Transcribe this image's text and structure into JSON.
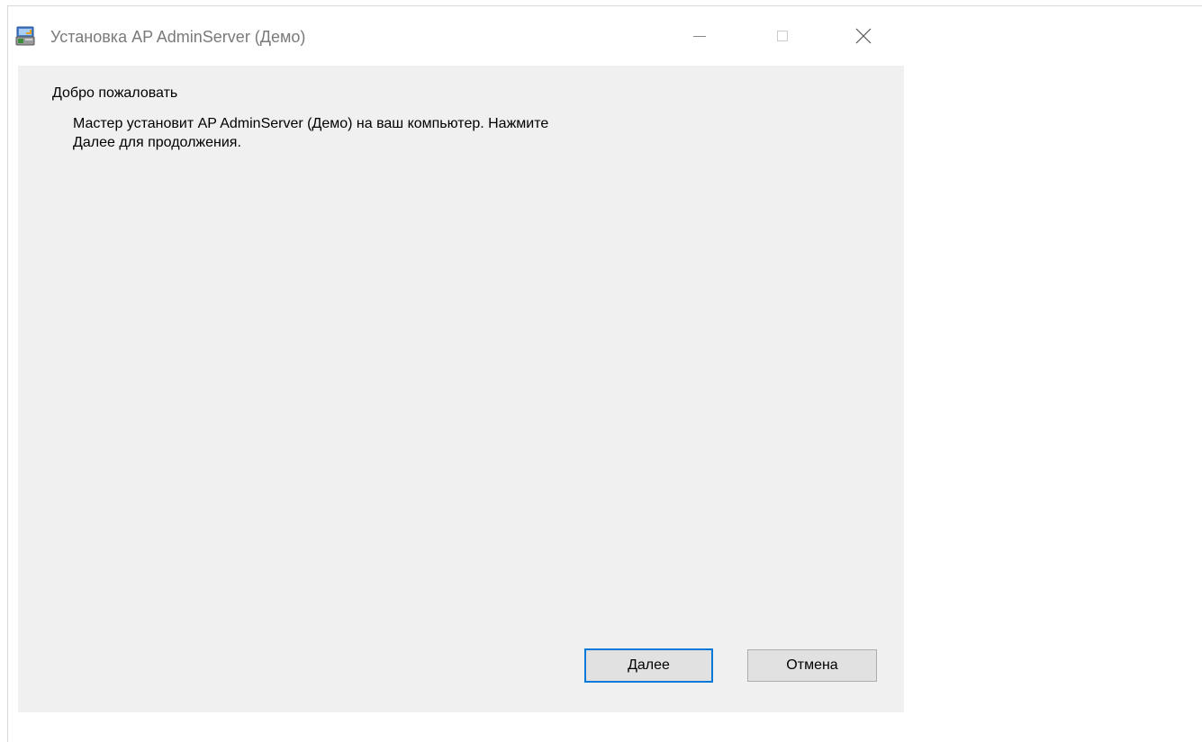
{
  "window": {
    "title": "Установка AP AdminServer (Демо)",
    "icon": "installer-icon",
    "controls": {
      "minimize_icon": "minimize-icon",
      "maximize_icon": "maximize-icon",
      "close_icon": "close-icon"
    }
  },
  "content": {
    "heading": "Добро пожаловать",
    "description_lines": [
      "Мастер установит AP AdminServer (Демо) на ваш компьютер. Нажмите",
      "Далее для продолжения."
    ]
  },
  "buttons": {
    "next_label": "Далее",
    "cancel_label": "Отмена"
  },
  "colors": {
    "accent": "#0078d7",
    "dialog_background": "#f0f0f0",
    "title_text": "#7a7a7a"
  }
}
